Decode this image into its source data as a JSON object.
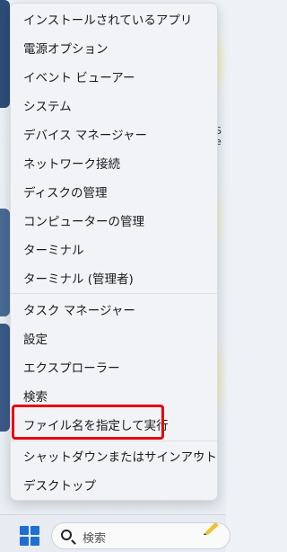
{
  "menu": {
    "items": [
      {
        "label": "インストールされているアプリ"
      },
      {
        "label": "電源オプション"
      },
      {
        "label": "イベント ビューアー"
      },
      {
        "label": "システム"
      },
      {
        "label": "デバイス マネージャー"
      },
      {
        "label": "ネットワーク接続"
      },
      {
        "label": "ディスクの管理"
      },
      {
        "label": "コンピューターの管理"
      },
      {
        "label": "ターミナル"
      },
      {
        "label": "ターミナル (管理者)"
      },
      {
        "label": "タスク マネージャー"
      },
      {
        "label": "設定"
      },
      {
        "label": "エクスプローラー"
      },
      {
        "label": "検索"
      },
      {
        "label": "ファイル名を指定して実行"
      },
      {
        "label": "シャットダウンまたはサインアウト",
        "chevron": "›"
      },
      {
        "label": "デスクトップ"
      }
    ],
    "highlight_color": "#e60012"
  },
  "desktop": {
    "edge_text": "S e"
  },
  "taskbar": {
    "search_placeholder": "検索",
    "start_color": "#1f6fd0"
  }
}
